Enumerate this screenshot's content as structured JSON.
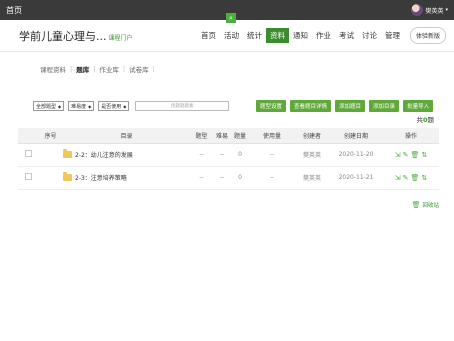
{
  "topbar": {
    "home_label": "首页",
    "username": "樊英英",
    "caret": "▾"
  },
  "header": {
    "course_title": "学前儿童心理与...",
    "portal_link": "课程门户",
    "nav": [
      "首页",
      "活动",
      "统计",
      "资料",
      "通知",
      "作业",
      "考试",
      "讨论",
      "管理"
    ],
    "active_nav": "资料",
    "new_version_button": "体验新版"
  },
  "subtabs": [
    "课程资料",
    "题库",
    "作业库",
    "试卷库"
  ],
  "active_subtab": "题库",
  "filters": {
    "type_select": "全部题型",
    "difficulty_select": "难易度",
    "used_select": "是否使用",
    "search_placeholder": "授题题题素"
  },
  "action_buttons": [
    "题型设置",
    "查看题目详情",
    "添加题目",
    "添加目录",
    "批量导入"
  ],
  "total": {
    "prefix": "共",
    "count": "0",
    "suffix": "题"
  },
  "table": {
    "headers": [
      "序号",
      "目录",
      "题型",
      "难易",
      "题量",
      "使用量",
      "创建者",
      "创建日期",
      "操作"
    ],
    "rows": [
      {
        "dir": "2-2：幼儿注意的发展",
        "type": "--",
        "difficulty": "--",
        "qty": "0",
        "usage": "--",
        "creator": "樊英英",
        "date": "2020-11-20"
      },
      {
        "dir": "2-3：注意培养策略",
        "type": "--",
        "difficulty": "--",
        "qty": "0",
        "usage": "--",
        "creator": "樊英英",
        "date": "2020-11-21"
      }
    ]
  },
  "recycle_label": "回收站",
  "icons": {
    "ops": [
      "move-icon",
      "edit-icon",
      "delete-icon",
      "sort-icon"
    ],
    "search": "search-icon",
    "trash": "trash-icon"
  },
  "colors": {
    "accent": "#5fa83a",
    "topbar": "#3a3a3a"
  }
}
